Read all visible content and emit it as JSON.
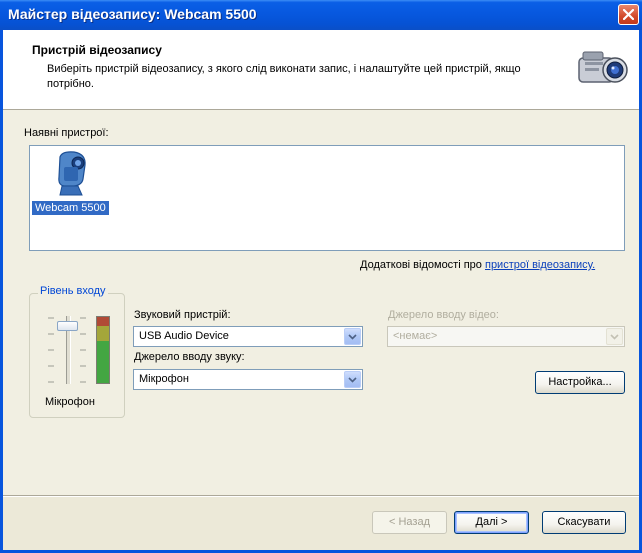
{
  "window": {
    "title": "Майстер відеозапису: Webcam 5500"
  },
  "header": {
    "title": "Пристрій відеозапису",
    "description": "Виберіть пристрій відеозапису, з якого слід виконати запис, і налаштуйте цей пристрій, якщо потрібно."
  },
  "devices": {
    "label": "Наявні пристрої:",
    "items": [
      {
        "name": "Webcam 5500",
        "icon": "webcam-icon",
        "selected": true
      }
    ]
  },
  "more_info": {
    "prefix": "Додаткові відомості про",
    "link": "пристрої відеозапису."
  },
  "input_level": {
    "caption": "Рівень входу",
    "mic_label": "Мікрофон",
    "slider_level": 0.75,
    "meter_level": 0.86
  },
  "audio_device": {
    "label": "Звуковий пристрій:",
    "value": "USB Audio Device"
  },
  "audio_source": {
    "label": "Джерело вводу звуку:",
    "value": "Мікрофон"
  },
  "video_source": {
    "label": "Джерело вводу відео:",
    "value": "<немає>",
    "disabled": true
  },
  "buttons": {
    "settings": "Настройка...",
    "back": "< Назад",
    "next": "Далі >",
    "cancel": "Скасувати"
  },
  "colors": {
    "titlebar": "#0758df",
    "selection": "#316ac5",
    "link": "#0a3fbb",
    "group_caption": "#0046d5"
  }
}
